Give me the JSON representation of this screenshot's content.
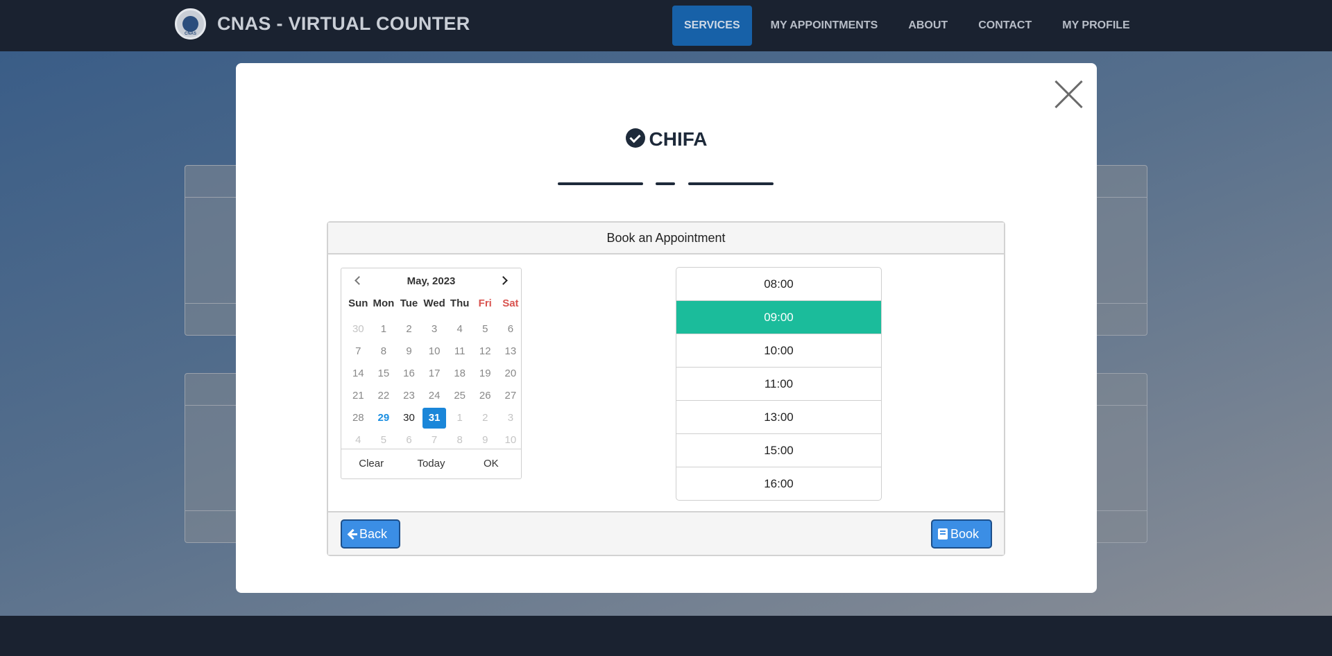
{
  "brand": {
    "title": "CNAS - VIRTUAL COUNTER",
    "logo_text": "CNAS"
  },
  "nav": {
    "items": [
      {
        "label": "SERVICES",
        "active": true
      },
      {
        "label": "MY APPOINTMENTS",
        "active": false
      },
      {
        "label": "ABOUT",
        "active": false
      },
      {
        "label": "CONTACT",
        "active": false
      },
      {
        "label": "MY PROFILE",
        "active": false
      }
    ]
  },
  "modal": {
    "title": "CHIFA",
    "panel": {
      "header": "Book an Appointment",
      "back_label": "Back",
      "book_label": "Book"
    },
    "calendar": {
      "month_label": "May, 2023",
      "weekdays": [
        "Sun",
        "Mon",
        "Tue",
        "Wed",
        "Thu",
        "Fri",
        "Sat"
      ],
      "days": [
        {
          "d": "30",
          "s": "muted"
        },
        {
          "d": "1",
          "s": ""
        },
        {
          "d": "2",
          "s": ""
        },
        {
          "d": "3",
          "s": ""
        },
        {
          "d": "4",
          "s": ""
        },
        {
          "d": "5",
          "s": ""
        },
        {
          "d": "6",
          "s": ""
        },
        {
          "d": "7",
          "s": ""
        },
        {
          "d": "8",
          "s": ""
        },
        {
          "d": "9",
          "s": ""
        },
        {
          "d": "10",
          "s": ""
        },
        {
          "d": "11",
          "s": ""
        },
        {
          "d": "12",
          "s": ""
        },
        {
          "d": "13",
          "s": ""
        },
        {
          "d": "14",
          "s": ""
        },
        {
          "d": "15",
          "s": ""
        },
        {
          "d": "16",
          "s": ""
        },
        {
          "d": "17",
          "s": ""
        },
        {
          "d": "18",
          "s": ""
        },
        {
          "d": "19",
          "s": ""
        },
        {
          "d": "20",
          "s": ""
        },
        {
          "d": "21",
          "s": ""
        },
        {
          "d": "22",
          "s": ""
        },
        {
          "d": "23",
          "s": ""
        },
        {
          "d": "24",
          "s": ""
        },
        {
          "d": "25",
          "s": ""
        },
        {
          "d": "26",
          "s": ""
        },
        {
          "d": "27",
          "s": ""
        },
        {
          "d": "28",
          "s": ""
        },
        {
          "d": "29",
          "s": "today"
        },
        {
          "d": "30",
          "s": "avail"
        },
        {
          "d": "31",
          "s": "selected"
        },
        {
          "d": "1",
          "s": "muted"
        },
        {
          "d": "2",
          "s": "muted"
        },
        {
          "d": "3",
          "s": "muted"
        },
        {
          "d": "4",
          "s": "muted"
        },
        {
          "d": "5",
          "s": "muted"
        },
        {
          "d": "6",
          "s": "muted"
        },
        {
          "d": "7",
          "s": "muted"
        },
        {
          "d": "8",
          "s": "muted"
        },
        {
          "d": "9",
          "s": "muted"
        },
        {
          "d": "10",
          "s": "muted"
        }
      ],
      "footer": {
        "clear": "Clear",
        "today": "Today",
        "ok": "OK"
      }
    },
    "times": [
      {
        "label": "08:00",
        "selected": false
      },
      {
        "label": "09:00",
        "selected": true
      },
      {
        "label": "10:00",
        "selected": false
      },
      {
        "label": "11:00",
        "selected": false
      },
      {
        "label": "13:00",
        "selected": false
      },
      {
        "label": "15:00",
        "selected": false
      },
      {
        "label": "16:00",
        "selected": false
      }
    ]
  },
  "colors": {
    "navbar": "#1a2230",
    "nav_active": "#1761a8",
    "selected_time": "#1bbc9b",
    "selected_day": "#1a86d9",
    "button": "#3b8ee5"
  }
}
